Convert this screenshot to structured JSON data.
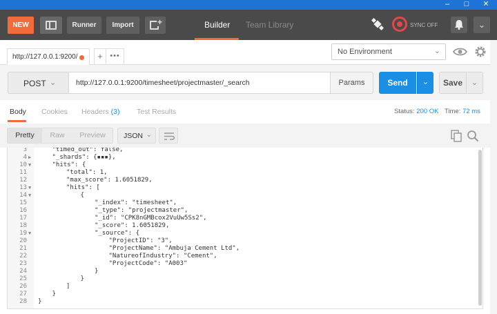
{
  "header": {
    "new_label": "NEW",
    "runner_label": "Runner",
    "import_label": "Import",
    "builder_tab": "Builder",
    "team_library_tab": "Team Library",
    "sync_label": "SYNC OFF",
    "accent_color": "#f26b3a"
  },
  "request_tab": {
    "label": "http://127.0.0.1:9200/",
    "add_label": "+",
    "more_label": "•••"
  },
  "environment": {
    "selected": "No Environment"
  },
  "url_bar": {
    "method": "POST",
    "url": "http://127.0.0.1:9200/timesheet/projectmaster/_search",
    "params_label": "Params",
    "send_label": "Send",
    "save_label": "Save",
    "send_color": "#1a8fe3"
  },
  "response_tabs": {
    "body": "Body",
    "cookies": "Cookies",
    "headers": "Headers",
    "headers_count": "(3)",
    "test_results": "Test Results",
    "status_label": "Status:",
    "status_value": "200 OK",
    "time_label": "Time:",
    "time_value": "72 ms"
  },
  "response_toolbar": {
    "pretty": "Pretty",
    "raw": "Raw",
    "preview": "Preview",
    "format": "JSON"
  },
  "code_lines": [
    {
      "n": "3",
      "fold": "",
      "indent": 1,
      "text": "\"timed_out\": false,"
    },
    {
      "n": "4",
      "fold": "▶",
      "indent": 1,
      "text": "\"_shards\": {▪▪▪},"
    },
    {
      "n": "10",
      "fold": "▼",
      "indent": 1,
      "text": "\"hits\": {"
    },
    {
      "n": "11",
      "fold": "",
      "indent": 2,
      "text": "\"total\": 1,"
    },
    {
      "n": "12",
      "fold": "",
      "indent": 2,
      "text": "\"max_score\": 1.6051829,"
    },
    {
      "n": "13",
      "fold": "▼",
      "indent": 2,
      "text": "\"hits\": ["
    },
    {
      "n": "14",
      "fold": "▼",
      "indent": 3,
      "text": "{"
    },
    {
      "n": "15",
      "fold": "",
      "indent": 4,
      "text": "\"_index\": \"timesheet\","
    },
    {
      "n": "16",
      "fold": "",
      "indent": 4,
      "text": "\"_type\": \"projectmaster\","
    },
    {
      "n": "17",
      "fold": "",
      "indent": 4,
      "text": "\"_id\": \"CPK8nGMBcox2VuUw5Ss2\","
    },
    {
      "n": "18",
      "fold": "",
      "indent": 4,
      "text": "\"_score\": 1.6051829,"
    },
    {
      "n": "19",
      "fold": "▼",
      "indent": 4,
      "text": "\"_source\": {"
    },
    {
      "n": "20",
      "fold": "",
      "indent": 5,
      "text": "\"ProjectID\": \"3\","
    },
    {
      "n": "21",
      "fold": "",
      "indent": 5,
      "text": "\"ProjectName\": \"Ambuja Cement Ltd\","
    },
    {
      "n": "22",
      "fold": "",
      "indent": 5,
      "text": "\"NatureofIndustry\": \"Cement\","
    },
    {
      "n": "23",
      "fold": "",
      "indent": 5,
      "text": "\"ProjectCode\": \"A003\""
    },
    {
      "n": "24",
      "fold": "",
      "indent": 4,
      "text": "}"
    },
    {
      "n": "25",
      "fold": "",
      "indent": 3,
      "text": "}"
    },
    {
      "n": "26",
      "fold": "",
      "indent": 2,
      "text": "]"
    },
    {
      "n": "27",
      "fold": "",
      "indent": 1,
      "text": "}"
    },
    {
      "n": "28",
      "fold": "",
      "indent": 0,
      "text": "}"
    }
  ]
}
